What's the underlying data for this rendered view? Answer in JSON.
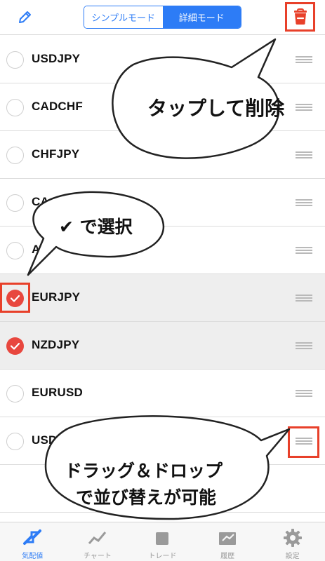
{
  "header": {
    "edit_icon": "pencil-icon",
    "segments": [
      {
        "label": "シンプルモード",
        "active": false
      },
      {
        "label": "詳細モード",
        "active": true
      }
    ],
    "delete_icon": "trash-icon",
    "accent": "#2d7cf6",
    "highlight": "#e8402a"
  },
  "list": {
    "items": [
      {
        "symbol": "USDJPY",
        "checked": false
      },
      {
        "symbol": "CADCHF",
        "checked": false
      },
      {
        "symbol": "CHFJPY",
        "checked": false
      },
      {
        "symbol": "CA",
        "checked": false
      },
      {
        "symbol": "AU",
        "checked": false
      },
      {
        "symbol": "EURJPY",
        "checked": true
      },
      {
        "symbol": "NZDJPY",
        "checked": true
      },
      {
        "symbol": "EURUSD",
        "checked": false
      },
      {
        "symbol": "USDTRY",
        "checked": false
      }
    ]
  },
  "callouts": {
    "delete": "タップして削除",
    "select": "✔ で選択",
    "drag_line1": "ドラッグ＆ドロップ",
    "drag_line2": "で並び替えが可能"
  },
  "tabbar": {
    "tabs": [
      {
        "label": "気配値",
        "icon": "quotes-icon",
        "active": true
      },
      {
        "label": "チャート",
        "icon": "chart-icon",
        "active": false
      },
      {
        "label": "トレード",
        "icon": "trade-icon",
        "active": false
      },
      {
        "label": "履歴",
        "icon": "history-icon",
        "active": false
      },
      {
        "label": "設定",
        "icon": "gear-icon",
        "active": false
      }
    ]
  }
}
